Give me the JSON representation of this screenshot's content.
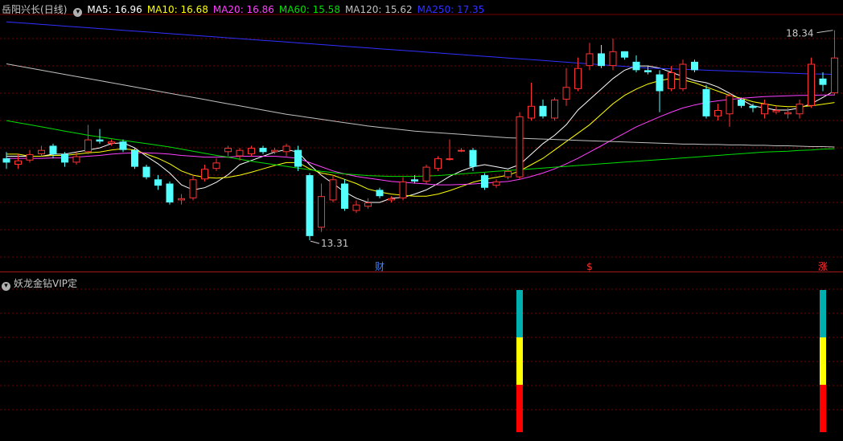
{
  "main": {
    "stock_name": "岳阳兴长",
    "period": "(日线)",
    "ma_labels": [
      {
        "text": "MA5: 16.96",
        "color": "#ffffff"
      },
      {
        "text": "MA10: 16.68",
        "color": "#ffff00"
      },
      {
        "text": "MA20: 16.86",
        "color": "#ff40ff"
      },
      {
        "text": "MA60: 15.58",
        "color": "#00e000"
      },
      {
        "text": "MA120: 15.62",
        "color": "#c0c0c0"
      },
      {
        "text": "MA250: 17.35",
        "color": "#3030ff"
      }
    ],
    "high_label": "18.34",
    "low_label": "13.31",
    "markers": [
      {
        "text": "财",
        "color": "#4080ff",
        "index": 32
      },
      {
        "text": "$",
        "color": "#ff3030",
        "index": 50
      },
      {
        "text": "涨",
        "color": "#ff3030",
        "index": 70
      }
    ]
  },
  "indicator": {
    "name": "妖龙金钻VIP定",
    "signal_indices": [
      44,
      70
    ],
    "bar_colors": [
      "#00b0b0",
      "#ffff00",
      "#ff0000"
    ]
  },
  "colors": {
    "up": "#ff3232",
    "down": "#54ffff",
    "grid": "#7a0000"
  },
  "chart_data": {
    "type": "candlestick",
    "ylim": [
      13.0,
      18.7
    ],
    "candles": [
      [
        15.35,
        15.25,
        15.5,
        15.1
      ],
      [
        15.2,
        15.3,
        15.45,
        15.1
      ],
      [
        15.3,
        15.45,
        15.55,
        15.25
      ],
      [
        15.45,
        15.55,
        15.65,
        15.4
      ],
      [
        15.65,
        15.45,
        15.7,
        15.35
      ],
      [
        15.45,
        15.25,
        15.5,
        15.15
      ],
      [
        15.25,
        15.4,
        15.5,
        15.2
      ],
      [
        15.5,
        15.8,
        16.15,
        15.45
      ],
      [
        15.8,
        15.75,
        16.05,
        15.7
      ],
      [
        15.7,
        15.75,
        15.8,
        15.65
      ],
      [
        15.75,
        15.55,
        15.8,
        15.5
      ],
      [
        15.55,
        15.15,
        15.6,
        15.1
      ],
      [
        15.15,
        14.9,
        15.2,
        14.85
      ],
      [
        14.85,
        14.7,
        14.95,
        14.6
      ],
      [
        14.75,
        14.3,
        14.8,
        14.25
      ],
      [
        14.35,
        14.4,
        14.5,
        14.25
      ],
      [
        14.4,
        14.85,
        14.95,
        14.35
      ],
      [
        14.85,
        15.1,
        15.2,
        14.8
      ],
      [
        15.1,
        15.25,
        15.35,
        15.05
      ],
      [
        15.5,
        15.6,
        15.65,
        15.4
      ],
      [
        15.4,
        15.55,
        15.6,
        15.3
      ],
      [
        15.45,
        15.6,
        15.65,
        15.4
      ],
      [
        15.6,
        15.5,
        15.65,
        15.45
      ],
      [
        15.5,
        15.55,
        15.6,
        15.45
      ],
      [
        15.5,
        15.65,
        15.7,
        15.4
      ],
      [
        15.55,
        15.15,
        15.65,
        15.05
      ],
      [
        14.95,
        13.5,
        15.0,
        13.4
      ],
      [
        13.7,
        14.45,
        14.75,
        13.6
      ],
      [
        14.35,
        14.85,
        14.95,
        14.3
      ],
      [
        14.75,
        14.15,
        14.85,
        14.1
      ],
      [
        14.1,
        14.25,
        14.35,
        14.05
      ],
      [
        14.2,
        14.3,
        14.4,
        14.15
      ],
      [
        14.6,
        14.45,
        14.65,
        14.4
      ],
      [
        14.35,
        14.4,
        14.45,
        14.3
      ],
      [
        14.4,
        14.8,
        14.9,
        14.35
      ],
      [
        14.85,
        14.8,
        14.95,
        14.75
      ],
      [
        14.8,
        15.15,
        15.2,
        14.75
      ],
      [
        15.1,
        15.35,
        15.4,
        15.05
      ],
      [
        15.35,
        15.35,
        15.8,
        15.3
      ],
      [
        15.55,
        15.55,
        15.6,
        15.5
      ],
      [
        15.55,
        15.15,
        15.6,
        15.05
      ],
      [
        14.95,
        14.65,
        15.0,
        14.6
      ],
      [
        14.7,
        14.8,
        14.85,
        14.65
      ],
      [
        14.9,
        15.05,
        15.1,
        14.85
      ],
      [
        14.9,
        16.35,
        16.45,
        14.85
      ],
      [
        16.3,
        16.6,
        17.15,
        16.25
      ],
      [
        16.6,
        16.35,
        16.75,
        16.3
      ],
      [
        16.3,
        16.75,
        16.8,
        16.25
      ],
      [
        16.75,
        17.05,
        17.5,
        16.6
      ],
      [
        17.0,
        17.5,
        17.75,
        16.95
      ],
      [
        17.55,
        17.85,
        18.1,
        17.45
      ],
      [
        17.85,
        17.55,
        18.05,
        17.5
      ],
      [
        17.55,
        17.9,
        18.2,
        17.45
      ],
      [
        17.9,
        17.75,
        17.9,
        17.7
      ],
      [
        17.65,
        17.45,
        17.8,
        17.4
      ],
      [
        17.45,
        17.4,
        17.55,
        17.35
      ],
      [
        17.35,
        16.95,
        17.45,
        16.45
      ],
      [
        17.0,
        17.4,
        17.55,
        16.95
      ],
      [
        17.0,
        17.6,
        17.7,
        16.95
      ],
      [
        17.65,
        17.45,
        17.7,
        17.4
      ],
      [
        17.0,
        16.35,
        17.1,
        16.3
      ],
      [
        16.35,
        16.5,
        16.65,
        16.25
      ],
      [
        16.4,
        16.85,
        16.9,
        16.1
      ],
      [
        16.75,
        16.6,
        16.8,
        16.55
      ],
      [
        16.6,
        16.55,
        16.65,
        16.45
      ],
      [
        16.4,
        16.65,
        16.75,
        16.3
      ],
      [
        16.45,
        16.5,
        16.6,
        16.4
      ],
      [
        16.4,
        16.45,
        16.55,
        16.3
      ],
      [
        16.4,
        16.65,
        16.75,
        16.3
      ],
      [
        16.6,
        17.6,
        17.75,
        16.55
      ],
      [
        17.25,
        17.1,
        17.4,
        16.95
      ],
      [
        16.9,
        17.75,
        18.4,
        16.85
      ]
    ],
    "ma_series": {
      "MA5": [
        15.4,
        15.4,
        15.4,
        15.4,
        15.45,
        15.45,
        15.5,
        15.55,
        15.6,
        15.7,
        15.72,
        15.6,
        15.4,
        15.22,
        15.0,
        14.72,
        14.6,
        14.65,
        14.78,
        14.96,
        15.2,
        15.3,
        15.4,
        15.5,
        15.56,
        15.5,
        15.2,
        14.95,
        14.75,
        14.55,
        14.4,
        14.3,
        14.3,
        14.4,
        14.42,
        14.5,
        14.6,
        14.75,
        14.92,
        15.05,
        15.15,
        15.2,
        15.15,
        15.1,
        15.2,
        15.45,
        15.7,
        15.9,
        16.15,
        16.5,
        16.75,
        17.0,
        17.25,
        17.45,
        17.55,
        17.55,
        17.5,
        17.4,
        17.3,
        17.2,
        17.15,
        17.05,
        16.9,
        16.75,
        16.6,
        16.55,
        16.5,
        16.5,
        16.55,
        16.65,
        16.8,
        16.96
      ],
      "MA10": [
        15.45,
        15.45,
        15.4,
        15.4,
        15.42,
        15.42,
        15.45,
        15.48,
        15.5,
        15.55,
        15.58,
        15.55,
        15.45,
        15.35,
        15.22,
        15.05,
        14.95,
        14.9,
        14.88,
        14.9,
        14.95,
        15.02,
        15.1,
        15.18,
        15.25,
        15.25,
        15.1,
        15.0,
        14.95,
        14.85,
        14.75,
        14.62,
        14.55,
        14.5,
        14.47,
        14.45,
        14.45,
        14.5,
        14.58,
        14.68,
        14.78,
        14.85,
        14.9,
        14.95,
        15.05,
        15.2,
        15.35,
        15.55,
        15.75,
        15.95,
        16.15,
        16.4,
        16.65,
        16.85,
        17.0,
        17.12,
        17.2,
        17.25,
        17.22,
        17.15,
        17.05,
        16.95,
        16.85,
        16.78,
        16.7,
        16.65,
        16.6,
        16.58,
        16.58,
        16.6,
        16.64,
        16.68
      ],
      "MA20": [
        15.35,
        15.35,
        15.35,
        15.35,
        15.36,
        15.36,
        15.38,
        15.4,
        15.42,
        15.45,
        15.47,
        15.48,
        15.48,
        15.47,
        15.45,
        15.42,
        15.4,
        15.38,
        15.38,
        15.38,
        15.4,
        15.4,
        15.4,
        15.4,
        15.38,
        15.35,
        15.25,
        15.15,
        15.05,
        14.98,
        14.92,
        14.88,
        14.84,
        14.8,
        14.78,
        14.76,
        14.74,
        14.72,
        14.72,
        14.73,
        14.74,
        14.76,
        14.78,
        14.8,
        14.85,
        14.92,
        15.0,
        15.1,
        15.22,
        15.35,
        15.5,
        15.65,
        15.8,
        15.95,
        16.1,
        16.22,
        16.34,
        16.45,
        16.55,
        16.62,
        16.68,
        16.72,
        16.75,
        16.78,
        16.8,
        16.82,
        16.83,
        16.84,
        16.85,
        16.85,
        16.86,
        16.86
      ],
      "MA60": [
        16.25,
        16.2,
        16.15,
        16.1,
        16.05,
        16.0,
        15.95,
        15.9,
        15.86,
        15.82,
        15.78,
        15.74,
        15.7,
        15.66,
        15.62,
        15.57,
        15.52,
        15.47,
        15.42,
        15.38,
        15.33,
        15.28,
        15.24,
        15.2,
        15.16,
        15.12,
        15.08,
        15.04,
        15.01,
        14.98,
        14.96,
        14.94,
        14.93,
        14.92,
        14.92,
        14.92,
        14.93,
        14.94,
        14.96,
        14.98,
        15.0,
        15.02,
        15.04,
        15.06,
        15.08,
        15.1,
        15.12,
        15.14,
        15.16,
        15.18,
        15.2,
        15.22,
        15.24,
        15.26,
        15.28,
        15.3,
        15.32,
        15.34,
        15.36,
        15.38,
        15.4,
        15.42,
        15.44,
        15.46,
        15.48,
        15.5,
        15.51,
        15.52,
        15.54,
        15.55,
        15.57,
        15.58
      ],
      "MA120": [
        17.6,
        17.55,
        17.5,
        17.45,
        17.4,
        17.35,
        17.3,
        17.25,
        17.2,
        17.15,
        17.1,
        17.05,
        17.0,
        16.95,
        16.9,
        16.85,
        16.8,
        16.75,
        16.7,
        16.65,
        16.6,
        16.55,
        16.5,
        16.45,
        16.4,
        16.36,
        16.32,
        16.28,
        16.24,
        16.2,
        16.16,
        16.12,
        16.09,
        16.06,
        16.03,
        16.0,
        15.98,
        15.96,
        15.94,
        15.92,
        15.9,
        15.88,
        15.86,
        15.84,
        15.83,
        15.82,
        15.81,
        15.8,
        15.79,
        15.78,
        15.77,
        15.76,
        15.75,
        15.74,
        15.73,
        15.72,
        15.71,
        15.7,
        15.69,
        15.69,
        15.68,
        15.68,
        15.67,
        15.67,
        15.66,
        15.66,
        15.65,
        15.65,
        15.64,
        15.63,
        15.63,
        15.62
      ],
      "MA250": [
        18.6,
        18.58,
        18.56,
        18.54,
        18.52,
        18.5,
        18.48,
        18.46,
        18.44,
        18.42,
        18.4,
        18.38,
        18.36,
        18.34,
        18.32,
        18.3,
        18.28,
        18.26,
        18.24,
        18.22,
        18.2,
        18.18,
        18.16,
        18.14,
        18.12,
        18.1,
        18.08,
        18.06,
        18.04,
        18.02,
        18.0,
        17.98,
        17.96,
        17.94,
        17.92,
        17.9,
        17.88,
        17.86,
        17.84,
        17.82,
        17.8,
        17.78,
        17.76,
        17.74,
        17.72,
        17.7,
        17.68,
        17.66,
        17.64,
        17.62,
        17.6,
        17.58,
        17.56,
        17.54,
        17.52,
        17.5,
        17.49,
        17.48,
        17.47,
        17.46,
        17.45,
        17.44,
        17.43,
        17.42,
        17.41,
        17.4,
        17.39,
        17.38,
        17.37,
        17.36,
        17.36,
        17.35
      ]
    }
  }
}
